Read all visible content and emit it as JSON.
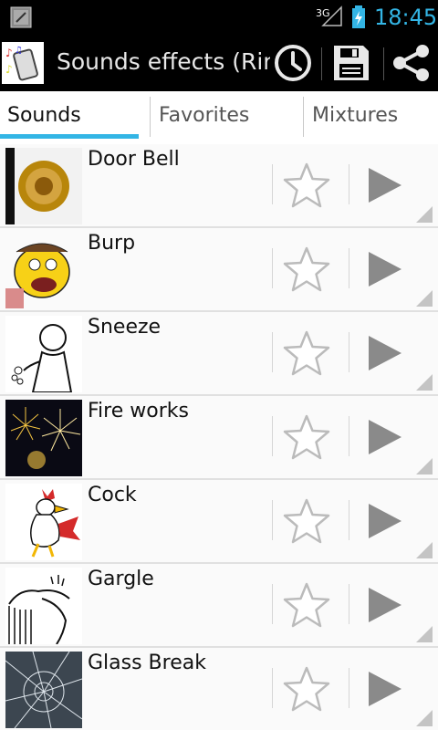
{
  "status_bar": {
    "network": "3G",
    "time": "18:45"
  },
  "action_bar": {
    "title": "Sounds effects (Ring",
    "icons": [
      "history-icon",
      "save-icon",
      "share-icon"
    ]
  },
  "tabs": [
    {
      "label": "Sounds",
      "active": true
    },
    {
      "label": "Favorites",
      "active": false
    },
    {
      "label": "Mixtures",
      "active": false
    }
  ],
  "sounds": [
    {
      "name": "Door Bell"
    },
    {
      "name": "Burp"
    },
    {
      "name": "Sneeze"
    },
    {
      "name": "Fire works"
    },
    {
      "name": "Cock"
    },
    {
      "name": "Gargle"
    },
    {
      "name": "Glass Break"
    }
  ],
  "colors": {
    "accent": "#33b5e5",
    "bar": "#000000",
    "list_bg": "#fafafa"
  }
}
